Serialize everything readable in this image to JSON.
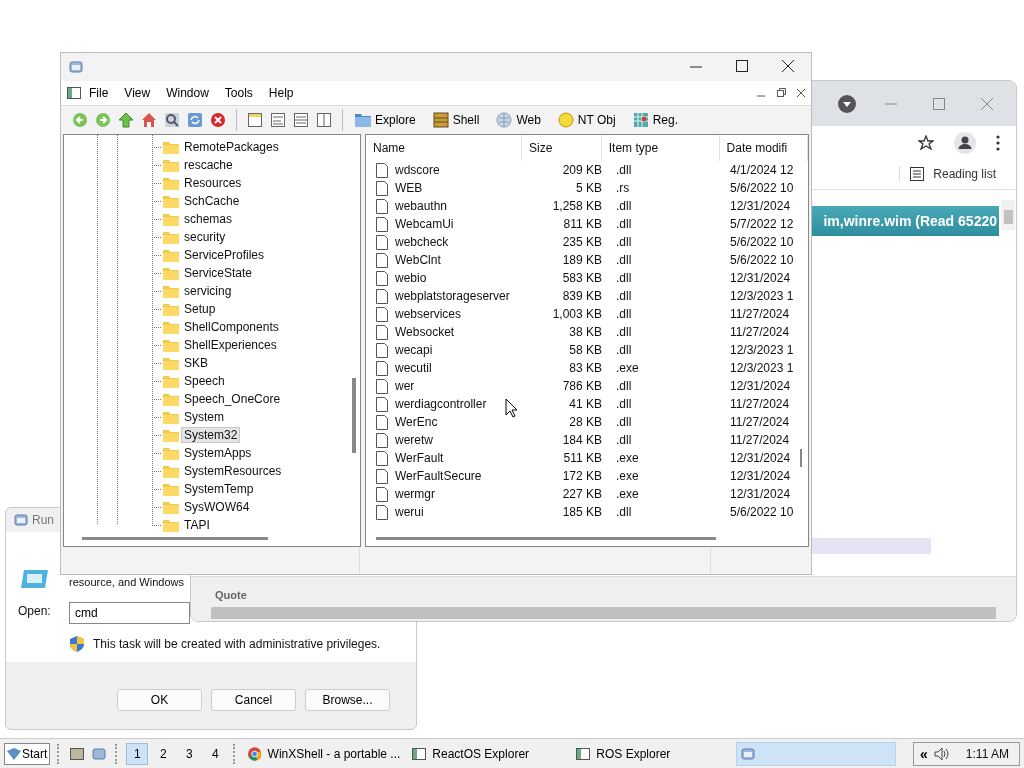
{
  "browser": {
    "reading_list": "Reading list",
    "banner": "im,winre.wim  (Read 65220",
    "bottom_panel": {
      "label": "Quote"
    }
  },
  "run_dialog": {
    "title": "Run",
    "description": "resource, and Windows",
    "open_label": "Open:",
    "open_value": "cmd",
    "admin_note": "This task will be created with administrative privileges.",
    "buttons": [
      "OK",
      "Cancel",
      "Browse..."
    ]
  },
  "explorer": {
    "menu": [
      "File",
      "View",
      "Window",
      "Tools",
      "Help"
    ],
    "toolbar_buttons": [
      "Explore",
      "Shell",
      "Web",
      "NT Obj",
      "Reg."
    ],
    "tree": [
      {
        "label": "RemotePackages",
        "selected": false
      },
      {
        "label": "rescache",
        "selected": false
      },
      {
        "label": "Resources",
        "selected": false
      },
      {
        "label": "SchCache",
        "selected": false
      },
      {
        "label": "schemas",
        "selected": false
      },
      {
        "label": "security",
        "selected": false
      },
      {
        "label": "ServiceProfiles",
        "selected": false
      },
      {
        "label": "ServiceState",
        "selected": false
      },
      {
        "label": "servicing",
        "selected": false
      },
      {
        "label": "Setup",
        "selected": false
      },
      {
        "label": "ShellComponents",
        "selected": false
      },
      {
        "label": "ShellExperiences",
        "selected": false
      },
      {
        "label": "SKB",
        "selected": false
      },
      {
        "label": "Speech",
        "selected": false
      },
      {
        "label": "Speech_OneCore",
        "selected": false
      },
      {
        "label": "System",
        "selected": false
      },
      {
        "label": "System32",
        "selected": true
      },
      {
        "label": "SystemApps",
        "selected": false
      },
      {
        "label": "SystemResources",
        "selected": false
      },
      {
        "label": "SystemTemp",
        "selected": false
      },
      {
        "label": "SysWOW64",
        "selected": false
      },
      {
        "label": "TAPI",
        "selected": false
      }
    ],
    "columns": [
      "Name",
      "Size",
      "Item type",
      "Date modifi"
    ],
    "files": [
      {
        "name": "wdscore",
        "size": "209 KB",
        "type": ".dll",
        "date": "4/1/2024 12"
      },
      {
        "name": "WEB",
        "size": "5 KB",
        "type": ".rs",
        "date": "5/6/2022 10"
      },
      {
        "name": "webauthn",
        "size": "1,258 KB",
        "type": ".dll",
        "date": "12/31/2024"
      },
      {
        "name": "WebcamUi",
        "size": "811 KB",
        "type": ".dll",
        "date": "5/7/2022 12"
      },
      {
        "name": "webcheck",
        "size": "235 KB",
        "type": ".dll",
        "date": "5/6/2022 10"
      },
      {
        "name": "WebClnt",
        "size": "189 KB",
        "type": ".dll",
        "date": "5/6/2022 10"
      },
      {
        "name": "webio",
        "size": "583 KB",
        "type": ".dll",
        "date": "12/31/2024"
      },
      {
        "name": "webplatstorageserver",
        "size": "839 KB",
        "type": ".dll",
        "date": "12/3/2023 1"
      },
      {
        "name": "webservices",
        "size": "1,003 KB",
        "type": ".dll",
        "date": "11/27/2024"
      },
      {
        "name": "Websocket",
        "size": "38 KB",
        "type": ".dll",
        "date": "11/27/2024"
      },
      {
        "name": "wecapi",
        "size": "58 KB",
        "type": ".dll",
        "date": "12/3/2023 1"
      },
      {
        "name": "wecutil",
        "size": "83 KB",
        "type": ".exe",
        "date": "12/3/2023 1"
      },
      {
        "name": "wer",
        "size": "786 KB",
        "type": ".dll",
        "date": "12/31/2024"
      },
      {
        "name": "werdiagcontroller",
        "size": "41 KB",
        "type": ".dll",
        "date": "11/27/2024"
      },
      {
        "name": "WerEnc",
        "size": "28 KB",
        "type": ".dll",
        "date": "11/27/2024"
      },
      {
        "name": "weretw",
        "size": "184 KB",
        "type": ".dll",
        "date": "11/27/2024"
      },
      {
        "name": "WerFault",
        "size": "511 KB",
        "type": ".exe",
        "date": "12/31/2024"
      },
      {
        "name": "WerFaultSecure",
        "size": "172 KB",
        "type": ".exe",
        "date": "12/31/2024"
      },
      {
        "name": "wermgr",
        "size": "227 KB",
        "type": ".exe",
        "date": "12/31/2024"
      },
      {
        "name": "werui",
        "size": "185 KB",
        "type": ".dll",
        "date": "5/6/2022 10"
      }
    ]
  },
  "taskbar": {
    "start": "Start",
    "desktops": [
      {
        "label": "1",
        "selected": true
      },
      {
        "label": "2",
        "selected": false
      },
      {
        "label": "3",
        "selected": false
      },
      {
        "label": "4",
        "selected": false
      }
    ],
    "tasks": [
      {
        "label": "WinXShell - a portable ...",
        "kind": "browser",
        "selected": false
      },
      {
        "label": "ReactOS Explorer",
        "kind": "explorer",
        "selected": false
      },
      {
        "label": "ROS Explorer",
        "kind": "explorer",
        "selected": false
      },
      {
        "kind": "window",
        "selected": true
      }
    ],
    "tray_chevron": "«",
    "clock": "1:11 AM"
  }
}
